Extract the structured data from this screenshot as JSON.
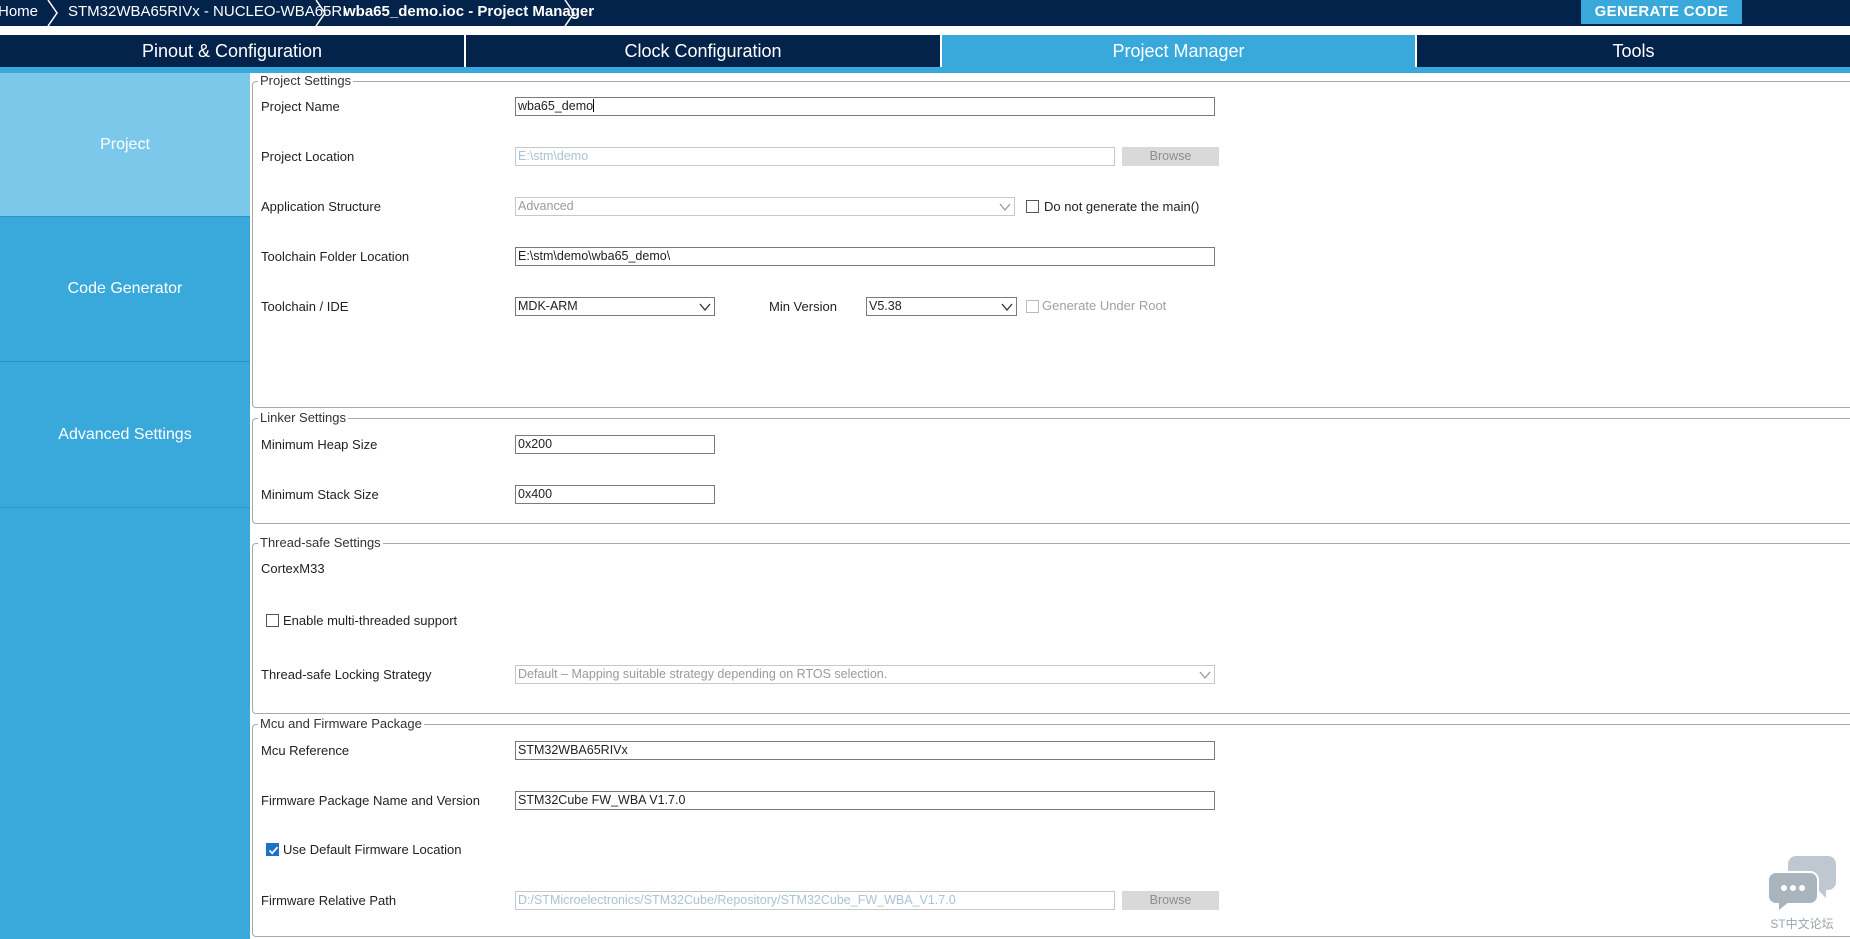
{
  "breadcrumb": {
    "home": "Home",
    "device": "STM32WBA65RIVx  -  NUCLEO-WBA65RI",
    "file": "wba65_demo.ioc - Project Manager"
  },
  "toolbar": {
    "generate_label": "GENERATE CODE"
  },
  "tabs": [
    {
      "label": "Pinout & Configuration"
    },
    {
      "label": "Clock Configuration"
    },
    {
      "label": "Project Manager"
    },
    {
      "label": "Tools"
    }
  ],
  "sidebar": {
    "items": [
      {
        "label": "Project"
      },
      {
        "label": "Code Generator"
      },
      {
        "label": "Advanced Settings"
      }
    ]
  },
  "project_settings": {
    "legend": "Project Settings",
    "project_name_label": "Project Name",
    "project_name_value": "wba65_demo",
    "project_location_label": "Project Location",
    "project_location_value": "E:\\stm\\demo",
    "browse_label": "Browse",
    "app_structure_label": "Application Structure",
    "app_structure_value": "Advanced",
    "no_main_label": "Do not generate the main()",
    "toolchain_folder_label": "Toolchain Folder Location",
    "toolchain_folder_value": "E:\\stm\\demo\\wba65_demo\\",
    "toolchain_ide_label": "Toolchain / IDE",
    "toolchain_ide_value": "MDK-ARM",
    "min_version_label": "Min Version",
    "min_version_value": "V5.38",
    "generate_under_root_label": "Generate Under Root"
  },
  "linker_settings": {
    "legend": "Linker Settings",
    "heap_label": "Minimum Heap Size",
    "heap_value": "0x200",
    "stack_label": "Minimum Stack Size",
    "stack_value": "0x400"
  },
  "thread_safe": {
    "legend": "Thread-safe Settings",
    "core_label": "CortexM33",
    "multithread_label": "Enable multi-threaded support",
    "strategy_label": "Thread-safe Locking Strategy",
    "strategy_value": "Default – Mapping suitable strategy depending on RTOS selection."
  },
  "mcu_fw": {
    "legend": "Mcu and Firmware Package",
    "mcu_ref_label": "Mcu Reference",
    "mcu_ref_value": "STM32WBA65RIVx",
    "fw_pkg_label": "Firmware Package Name and Version",
    "fw_pkg_value": "STM32Cube FW_WBA V1.7.0",
    "use_default_label": "Use Default Firmware Location",
    "fw_path_label": "Firmware Relative Path",
    "fw_path_value": "D:/STMicroelectronics/STM32Cube/Repository/STM32Cube_FW_WBA_V1.7.0",
    "browse_label": "Browse"
  },
  "watermark": {
    "text": "ST中文论坛"
  },
  "colors": {
    "navy": "#03234b",
    "accent": "#39a9dc",
    "sidebar_active": "#7cc8ea"
  }
}
